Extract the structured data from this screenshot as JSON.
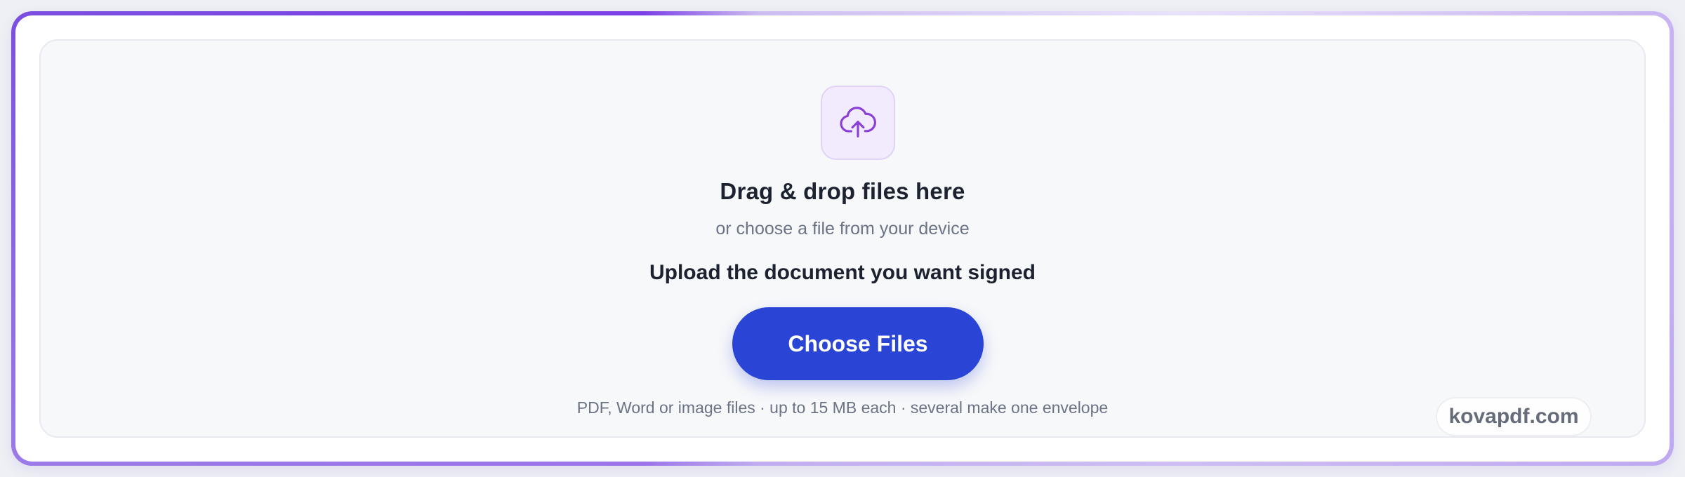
{
  "dropzone": {
    "icon": "cloud-upload-icon",
    "title": "Drag & drop files here",
    "subtitle": "or choose a file from your device",
    "instruction": "Upload the document you want signed",
    "button_label": "Choose Files",
    "hint": "PDF, Word or image files · up to 15 MB each · several make one envelope"
  },
  "watermark": "kovapdf.com",
  "colors": {
    "accent_purple": "#7b3fe6",
    "button_blue": "#2a45d6",
    "icon_purple": "#8a3fd6",
    "text_dark": "#1d2230",
    "text_muted": "#6b7385"
  }
}
